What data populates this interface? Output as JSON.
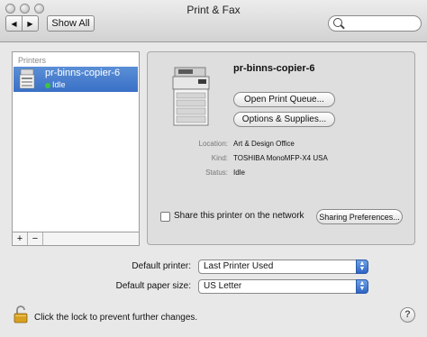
{
  "window": {
    "title": "Print & Fax"
  },
  "toolbar": {
    "back_icon": "◀",
    "forward_icon": "▶",
    "show_all_label": "Show All",
    "search_placeholder": ""
  },
  "printers_list": {
    "header": "Printers",
    "items": [
      {
        "name": "pr-binns-copier-6",
        "status": "Idle",
        "selected": true
      }
    ],
    "add_label": "+",
    "remove_label": "−"
  },
  "detail": {
    "printer_name": "pr-binns-copier-6",
    "open_queue_label": "Open Print Queue...",
    "options_label": "Options & Supplies...",
    "info": [
      {
        "label": "Location:",
        "value": "Art & Design Office"
      },
      {
        "label": "Kind:",
        "value": "TOSHIBA MonoMFP-X4 USA"
      },
      {
        "label": "Status:",
        "value": "Idle"
      }
    ],
    "share_label": "Share this printer on the network",
    "share_checked": false,
    "sharing_prefs_label": "Sharing Preferences..."
  },
  "defaults": {
    "default_printer_label": "Default printer:",
    "default_printer_value": "Last Printer Used",
    "default_paper_label": "Default paper size:",
    "default_paper_value": "US Letter"
  },
  "footer": {
    "lock_text": "Click the lock to prevent further changes.",
    "help_label": "?"
  },
  "colors": {
    "selection": "#3970c6",
    "status_idle": "#3ec43e",
    "popup_arrow": "#2e65c4"
  }
}
